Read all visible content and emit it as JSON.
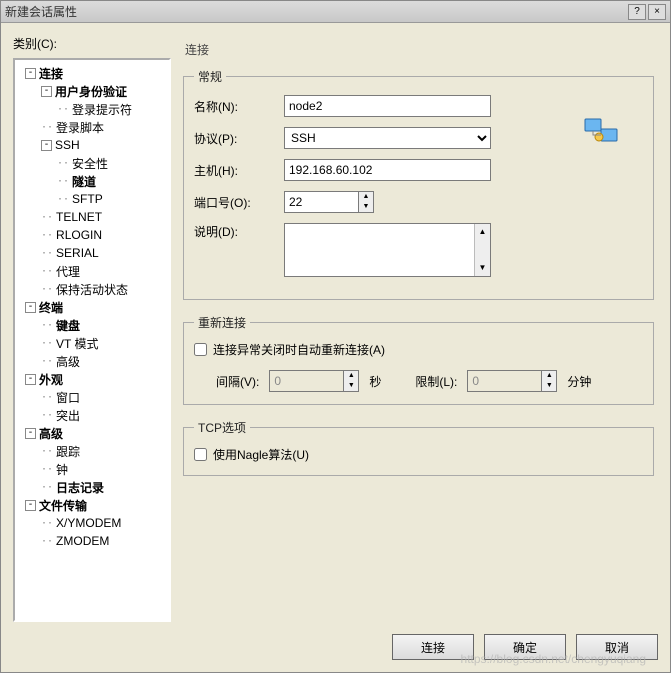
{
  "window": {
    "title": "新建会话属性",
    "help": "?",
    "close": "×"
  },
  "sidebar": {
    "category_label": "类别(C):",
    "items": [
      {
        "label": "连接",
        "bold": true,
        "expander": "-",
        "indent": 1
      },
      {
        "label": "用户身份验证",
        "bold": true,
        "expander": "-",
        "indent": 2
      },
      {
        "label": "登录提示符",
        "bold": false,
        "leaf": true,
        "indent": 3
      },
      {
        "label": "登录脚本",
        "bold": false,
        "leaf": true,
        "indent": 2
      },
      {
        "label": "SSH",
        "bold": false,
        "expander": "-",
        "indent": 2
      },
      {
        "label": "安全性",
        "bold": false,
        "leaf": true,
        "indent": 3
      },
      {
        "label": "隧道",
        "bold": true,
        "leaf": true,
        "indent": 3
      },
      {
        "label": "SFTP",
        "bold": false,
        "leaf": true,
        "indent": 3
      },
      {
        "label": "TELNET",
        "bold": false,
        "leaf": true,
        "indent": 2
      },
      {
        "label": "RLOGIN",
        "bold": false,
        "leaf": true,
        "indent": 2
      },
      {
        "label": "SERIAL",
        "bold": false,
        "leaf": true,
        "indent": 2
      },
      {
        "label": "代理",
        "bold": false,
        "leaf": true,
        "indent": 2
      },
      {
        "label": "保持活动状态",
        "bold": false,
        "leaf": true,
        "indent": 2
      },
      {
        "label": "终端",
        "bold": true,
        "expander": "-",
        "indent": 1
      },
      {
        "label": "键盘",
        "bold": true,
        "leaf": true,
        "indent": 2
      },
      {
        "label": "VT 模式",
        "bold": false,
        "leaf": true,
        "indent": 2
      },
      {
        "label": "高级",
        "bold": false,
        "leaf": true,
        "indent": 2
      },
      {
        "label": "外观",
        "bold": true,
        "expander": "-",
        "indent": 1
      },
      {
        "label": "窗口",
        "bold": false,
        "leaf": true,
        "indent": 2
      },
      {
        "label": "突出",
        "bold": false,
        "leaf": true,
        "indent": 2
      },
      {
        "label": "高级",
        "bold": true,
        "expander": "-",
        "indent": 1
      },
      {
        "label": "跟踪",
        "bold": false,
        "leaf": true,
        "indent": 2
      },
      {
        "label": "钟",
        "bold": false,
        "leaf": true,
        "indent": 2
      },
      {
        "label": "日志记录",
        "bold": true,
        "leaf": true,
        "indent": 2
      },
      {
        "label": "文件传输",
        "bold": true,
        "expander": "-",
        "indent": 1
      },
      {
        "label": "X/YMODEM",
        "bold": false,
        "leaf": true,
        "indent": 2
      },
      {
        "label": "ZMODEM",
        "bold": false,
        "leaf": true,
        "indent": 2
      }
    ]
  },
  "main": {
    "section_title": "连接",
    "general": {
      "legend": "常规",
      "name_label": "名称(N):",
      "name_value": "node2",
      "protocol_label": "协议(P):",
      "protocol_value": "SSH",
      "host_label": "主机(H):",
      "host_value": "192.168.60.102",
      "port_label": "端口号(O):",
      "port_value": "22",
      "desc_label": "说明(D):"
    },
    "reconnect": {
      "legend": "重新连接",
      "auto_label": "连接异常关闭时自动重新连接(A)",
      "interval_label": "间隔(V):",
      "interval_value": "0",
      "interval_unit": "秒",
      "limit_label": "限制(L):",
      "limit_value": "0",
      "limit_unit": "分钟"
    },
    "tcp": {
      "legend": "TCP选项",
      "nagle_label": "使用Nagle算法(U)"
    }
  },
  "footer": {
    "connect": "连接",
    "ok": "确定",
    "cancel": "取消"
  },
  "watermark": "https://blog.csdn.net/chengyuqiang"
}
